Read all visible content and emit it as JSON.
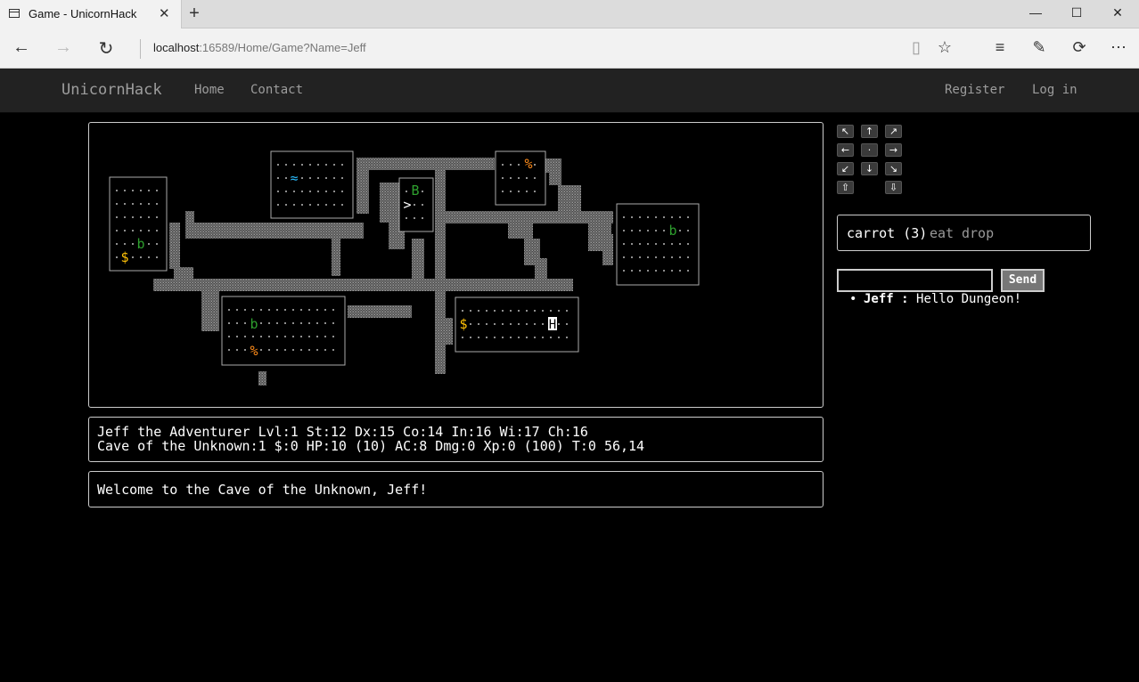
{
  "browser": {
    "tab_title": "Game - UnicornHack",
    "url_host": "localhost",
    "url_rest": ":16589/Home/Game?Name=Jeff"
  },
  "site": {
    "brand": "UnicornHack",
    "nav": [
      "Home",
      "Contact"
    ],
    "account": [
      "Register",
      "Log in"
    ]
  },
  "map": {
    "colors": {
      "wall": "#aaaaaa",
      "floor": "#bbbbbb",
      "corridor": "#777777",
      "gold": "#ffc107",
      "food": "#ff8c1a",
      "monster": "#2ea02e",
      "water": "#29b6f6",
      "player_bg": "#ffffff"
    },
    "glyphs": {
      "gold": "$",
      "food": "%",
      "monster_small": "b",
      "monster_big": "B",
      "water": "≈",
      "stairs_down": ">",
      "player": "H"
    }
  },
  "status": {
    "line1": "Jeff the Adventurer Lvl:1 St:12 Dx:15 Co:14 In:16 Wi:17 Ch:16",
    "line2": "Cave of the Unknown:1 $:0 HP:10 (10) AC:8 Dmg:0 Xp:0 (100) T:0 56,14"
  },
  "message": "Welcome to the Cave of the Unknown, Jeff!",
  "controls": {
    "directions": [
      "↖",
      "↑",
      "↗",
      "←",
      "·",
      "→",
      "↙",
      "↓",
      "↘"
    ],
    "up": "⇧",
    "down": "⇩"
  },
  "inventory": {
    "item": "carrot (3)",
    "actions": [
      "eat",
      "drop"
    ]
  },
  "chat": {
    "input_value": "",
    "send_label": "Send",
    "messages": [
      {
        "user": "Jeff",
        "separator": " : ",
        "text": "Hello Dungeon!"
      }
    ]
  }
}
